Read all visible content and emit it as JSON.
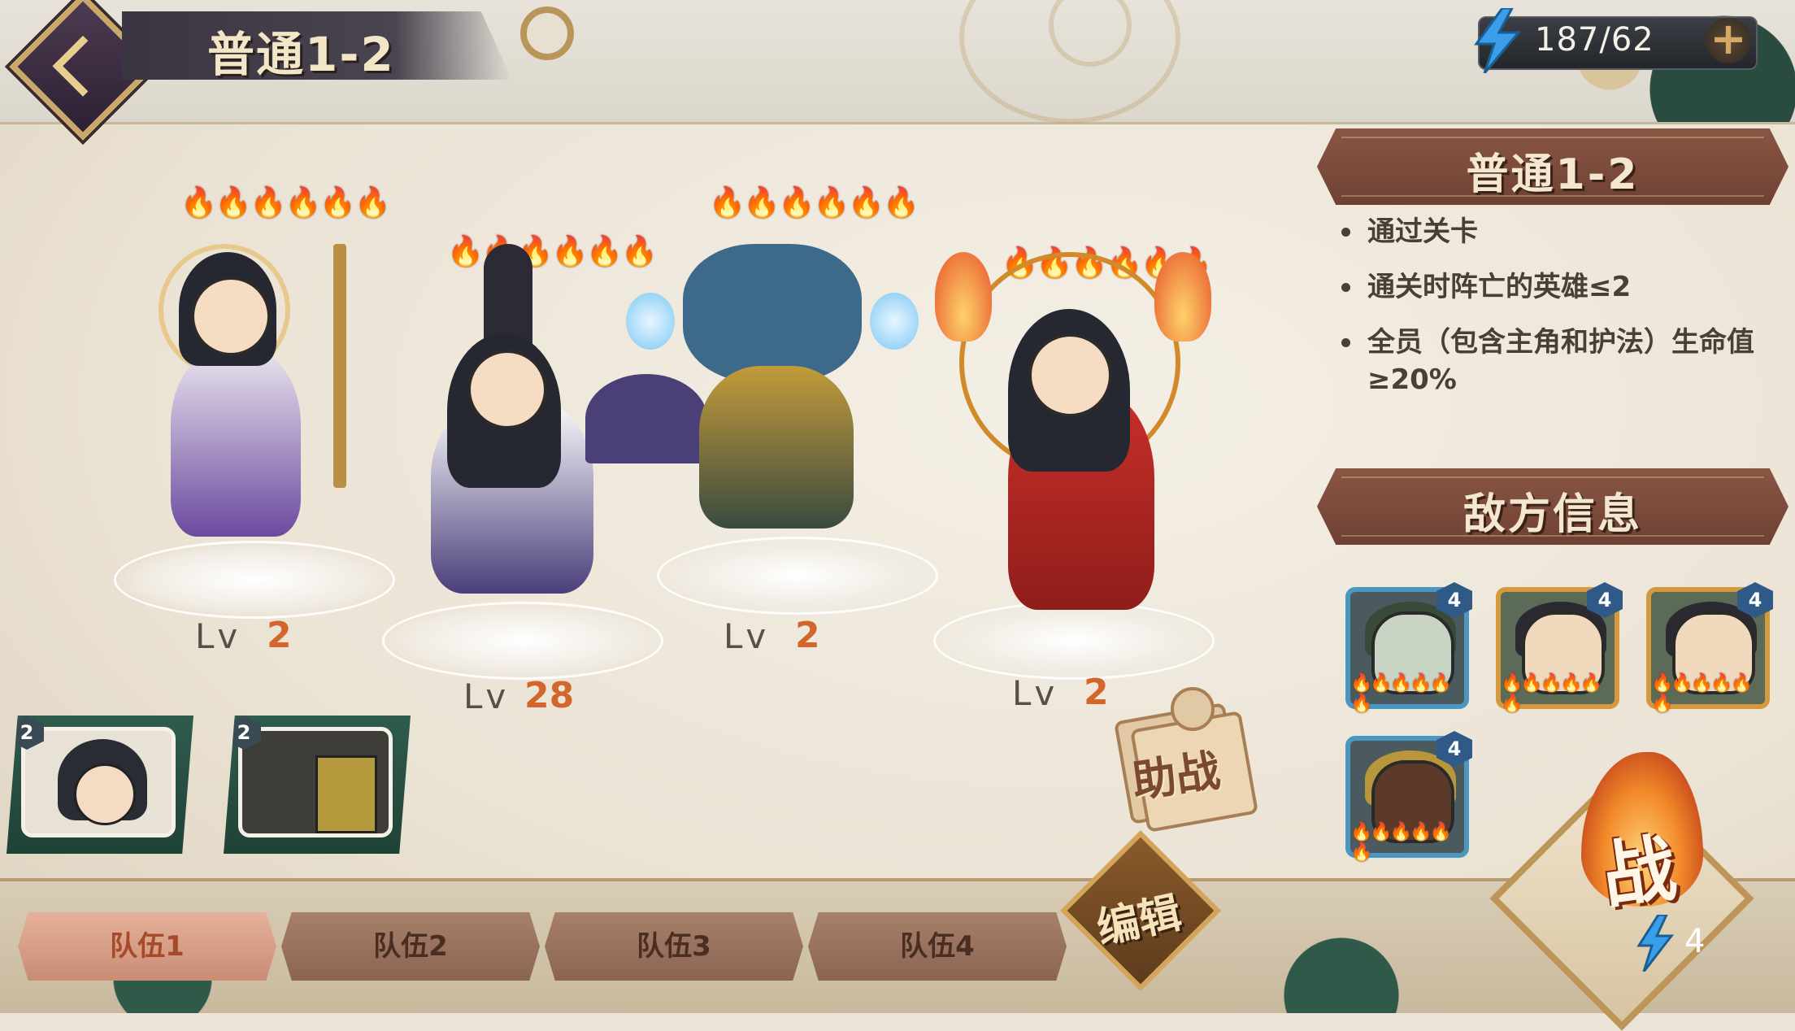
{
  "header": {
    "title": "普通1-2",
    "energy": "187/62",
    "plus_label": "+"
  },
  "stage_panel": {
    "title": "普通1-2",
    "conditions": [
      "通过关卡",
      "通关时阵亡的英雄≤2",
      "全员（包含主角和护法）生命值≥20%"
    ],
    "enemy_info_title": "敌方信息",
    "enemies": [
      {
        "level": "4",
        "frame": "blue"
      },
      {
        "level": "4",
        "frame": "gold"
      },
      {
        "level": "4",
        "frame": "gold"
      },
      {
        "level": "4",
        "frame": "blue"
      }
    ]
  },
  "heroes": [
    {
      "name": "halo-mage",
      "lv_label": "Lv",
      "level": "2",
      "stars_on": 3,
      "stars_total": 6
    },
    {
      "name": "fan-scholar",
      "lv_label": "Lv",
      "level": "28",
      "stars_on": 3,
      "stars_total": 6
    },
    {
      "name": "dragon-beast",
      "lv_label": "Lv",
      "level": "2",
      "stars_on": 3,
      "stars_total": 6
    },
    {
      "name": "fire-archer",
      "lv_label": "Lv",
      "level": "2",
      "stars_on": 3,
      "stars_total": 6
    }
  ],
  "reserve": [
    {
      "badge": "2"
    },
    {
      "badge": "2"
    }
  ],
  "assist_label": "助战",
  "edit_label": "编辑",
  "teams": [
    "队伍1",
    "队伍2",
    "队伍3",
    "队伍4"
  ],
  "fight": {
    "label": "战",
    "cost": "4"
  },
  "colors": {
    "accent_orange": "#d2662c",
    "ribbon": "#7a4a3a",
    "team_active": "#e6b19a"
  }
}
